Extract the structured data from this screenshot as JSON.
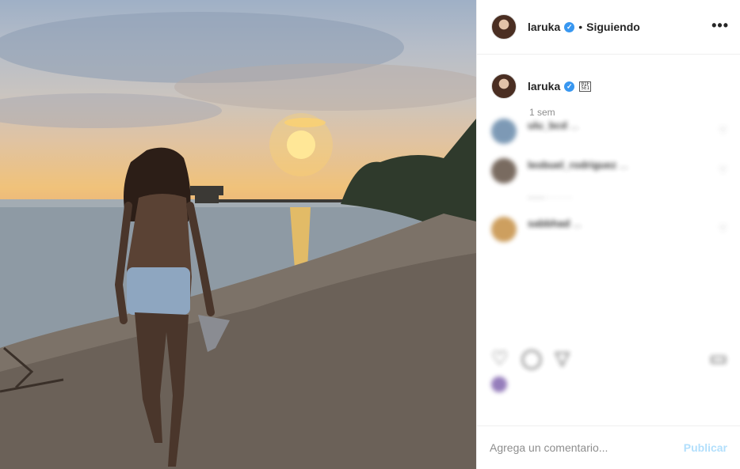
{
  "post": {
    "username": "laruka",
    "follow_status": "Siguiendo",
    "separator": "•",
    "more_icon": "more-icon",
    "verified_icon": "verified-badge-icon"
  },
  "caption": {
    "username": "laruka",
    "emoji": "unsupported-emoji-glyph",
    "time": "1 sem"
  },
  "comments": [
    {
      "username": "ulu_bcd",
      "text": "...",
      "meta": ""
    },
    {
      "username": "leobuel_rodriguez",
      "text": "...",
      "meta": ""
    },
    {
      "username": "sabbhad",
      "text": "...",
      "meta": ""
    }
  ],
  "likes": {
    "text": ""
  },
  "date": "",
  "add_comment": {
    "placeholder": "Agrega un comentario...",
    "publish_label": "Publicar"
  },
  "colors": {
    "accent": "#3897f0",
    "publish_disabled": "#b2dffc",
    "muted": "#8e8e8e"
  }
}
